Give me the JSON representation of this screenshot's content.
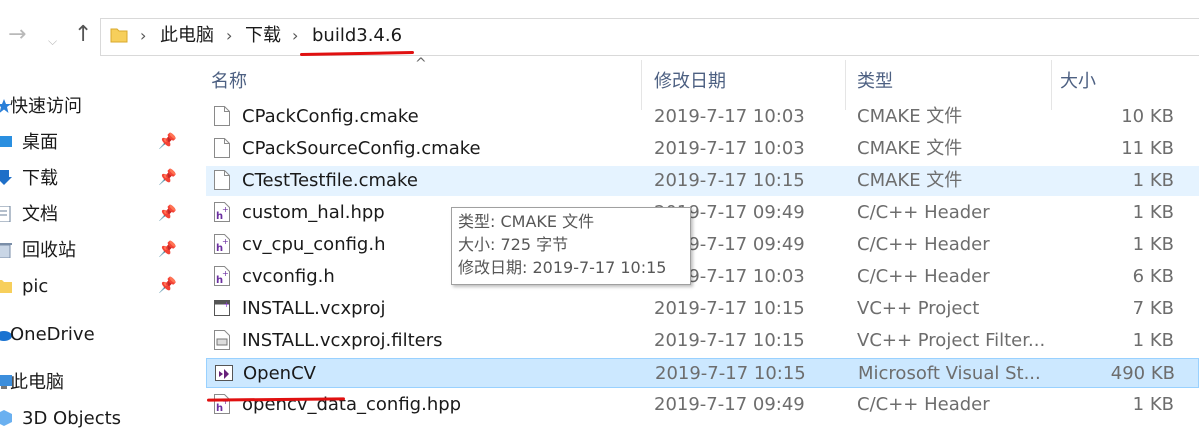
{
  "nav": {
    "forward_icon": "arrow-right-icon",
    "history_icon": "chevron-down-icon",
    "up_icon": "arrow-up-icon"
  },
  "breadcrumb": {
    "items": [
      "此电脑",
      "下载",
      "build3.4.6"
    ]
  },
  "sidebar": {
    "items": [
      {
        "label": "快速访问",
        "icon": "star-icon",
        "pinned": false
      },
      {
        "label": "桌面",
        "icon": "desktop-icon",
        "pinned": true
      },
      {
        "label": "下载",
        "icon": "download-icon",
        "pinned": true
      },
      {
        "label": "文档",
        "icon": "document-icon",
        "pinned": true
      },
      {
        "label": "回收站",
        "icon": "recycle-bin-icon",
        "pinned": true
      },
      {
        "label": "pic",
        "icon": "folder-icon",
        "pinned": true
      },
      {
        "label": "OneDrive",
        "icon": "cloud-icon",
        "pinned": false
      },
      {
        "label": "此电脑",
        "icon": "computer-icon",
        "pinned": false
      },
      {
        "label": "3D Objects",
        "icon": "3d-objects-icon",
        "pinned": false
      }
    ]
  },
  "columns": {
    "name": "名称",
    "modified": "修改日期",
    "type": "类型",
    "size": "大小"
  },
  "files": [
    {
      "name": "CPackConfig.cmake",
      "modified": "2019-7-17 10:03",
      "type": "CMAKE 文件",
      "size": "10 KB",
      "icon": "blank-file-icon"
    },
    {
      "name": "CPackSourceConfig.cmake",
      "modified": "2019-7-17 10:03",
      "type": "CMAKE 文件",
      "size": "11 KB",
      "icon": "blank-file-icon"
    },
    {
      "name": "CTestTestfile.cmake",
      "modified": "2019-7-17 10:15",
      "type": "CMAKE 文件",
      "size": "1 KB",
      "icon": "blank-file-icon"
    },
    {
      "name": "custom_hal.hpp",
      "modified": "2019-7-17 09:49",
      "type": "C/C++ Header",
      "size": "1 KB",
      "icon": "header-file-icon"
    },
    {
      "name": "cv_cpu_config.h",
      "modified": "2019-7-17 09:49",
      "type": "C/C++ Header",
      "size": "1 KB",
      "icon": "header-file-icon"
    },
    {
      "name": "cvconfig.h",
      "modified": "2019-7-17 10:03",
      "type": "C/C++ Header",
      "size": "6 KB",
      "icon": "header-file-icon"
    },
    {
      "name": "INSTALL.vcxproj",
      "modified": "2019-7-17 10:15",
      "type": "VC++ Project",
      "size": "7 KB",
      "icon": "vcxproj-icon"
    },
    {
      "name": "INSTALL.vcxproj.filters",
      "modified": "2019-7-17 10:15",
      "type": "VC++ Project Filter...",
      "size": "1 KB",
      "icon": "vcxproj-filters-icon"
    },
    {
      "name": "OpenCV",
      "modified": "2019-7-17 10:15",
      "type": "Microsoft Visual St...",
      "size": "490 KB",
      "icon": "visual-studio-solution-icon"
    },
    {
      "name": "opencv_data_config.hpp",
      "modified": "2019-7-17 09:49",
      "type": "C/C++ Header",
      "size": "1 KB",
      "icon": "header-file-icon"
    }
  ],
  "tooltip": {
    "type_line": "类型: CMAKE 文件",
    "size_line": "大小: 725 字节",
    "modified_line": "修改日期: 2019-7-17 10:15"
  },
  "colors": {
    "selection": "#cce8ff",
    "hover": "#e5f3ff",
    "header_text": "#4d6082",
    "annotation": "#e01010"
  }
}
